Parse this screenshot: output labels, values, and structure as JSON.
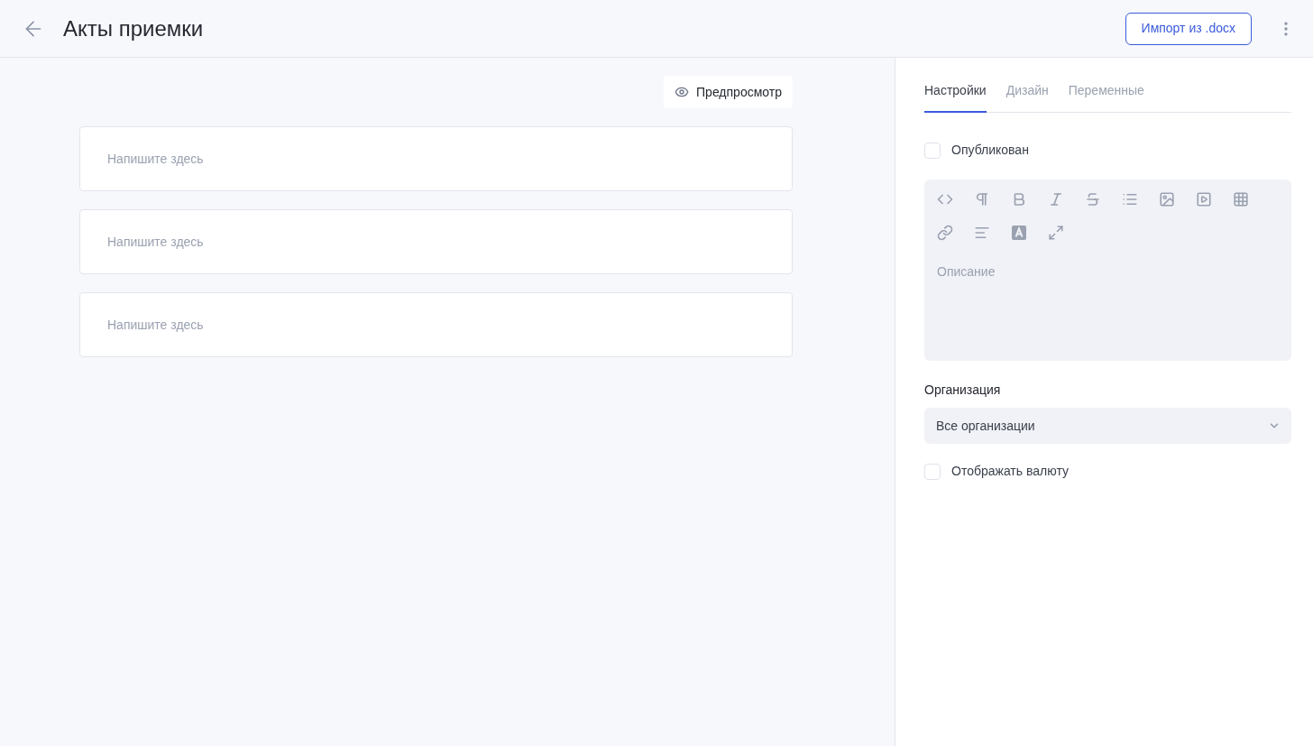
{
  "header": {
    "title": "Акты приемки",
    "import_button": "Импорт из .docx"
  },
  "preview_button": "Предпросмотр",
  "blocks": [
    {
      "placeholder": "Напишите здесь"
    },
    {
      "placeholder": "Напишите здесь"
    },
    {
      "placeholder": "Напишите здесь"
    }
  ],
  "tabs": [
    {
      "label": "Настройки",
      "selected": true
    },
    {
      "label": "Дизайн",
      "selected": false
    },
    {
      "label": "Переменные",
      "selected": false
    }
  ],
  "published": {
    "label": "Опубликован",
    "checked": false
  },
  "description": {
    "placeholder": "Описание"
  },
  "organization": {
    "label": "Организация",
    "value": "Все организации"
  },
  "show_currency": {
    "label": "Отображать валюту",
    "checked": false
  }
}
